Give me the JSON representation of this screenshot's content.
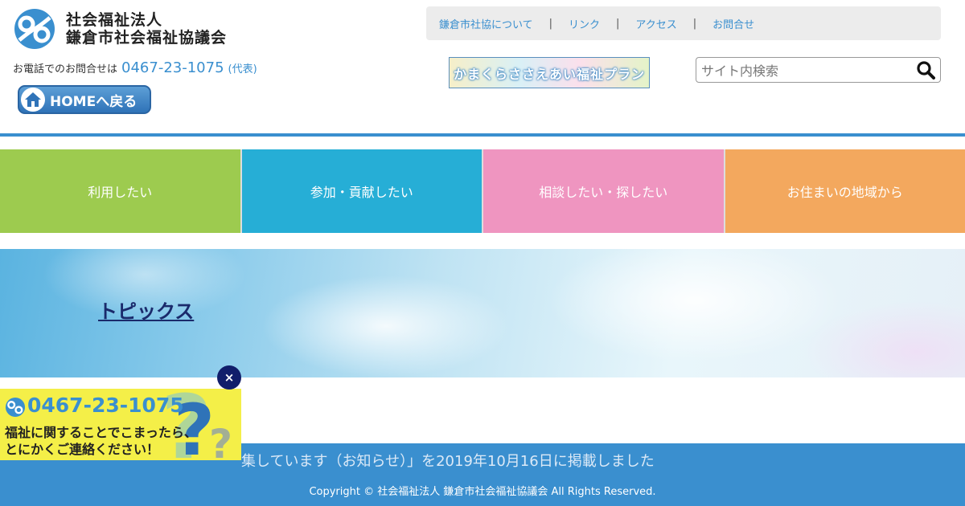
{
  "header": {
    "org_type": "社会福祉法人",
    "org_name": "鎌倉市社会福祉協議会",
    "phone_label": "お電話でのお問合せは",
    "phone_number": "0467-23-1075",
    "phone_note": "(代表)",
    "home_button": "HOMEへ戻る",
    "banner_text": "かまくらささえあい福祉プラン",
    "search_placeholder": "サイト内検索"
  },
  "top_nav": {
    "items": [
      "鎌倉市社協について",
      "リンク",
      "アクセス",
      "お問合せ"
    ],
    "separator": "|"
  },
  "categories": [
    {
      "label": "利用したい",
      "color": "#9dcb4f"
    },
    {
      "label": "参加・貢献したい",
      "color": "#26aed6"
    },
    {
      "label": "相談したい・探したい",
      "color": "#ef95c0"
    },
    {
      "label": "お住まいの地域から",
      "color": "#f3a85e"
    }
  ],
  "hero": {
    "title": "トピックス"
  },
  "content": {
    "partial_text": "集しています（お知らせ）」を2019年10月16日に掲載しました"
  },
  "footer": {
    "copyright": "Copyright © 社会福祉法人 鎌倉市社会福祉協議会 All Rights Reserved."
  },
  "popup": {
    "phone": "0467-23-1075",
    "line1": "福祉に関することでこまったら、",
    "line2": "とにかくご連絡ください！",
    "close_label": "×"
  },
  "colors": {
    "accent": "#3a8fcf",
    "popup_bg": "#f4ef48",
    "close_bg": "#111e6b"
  }
}
